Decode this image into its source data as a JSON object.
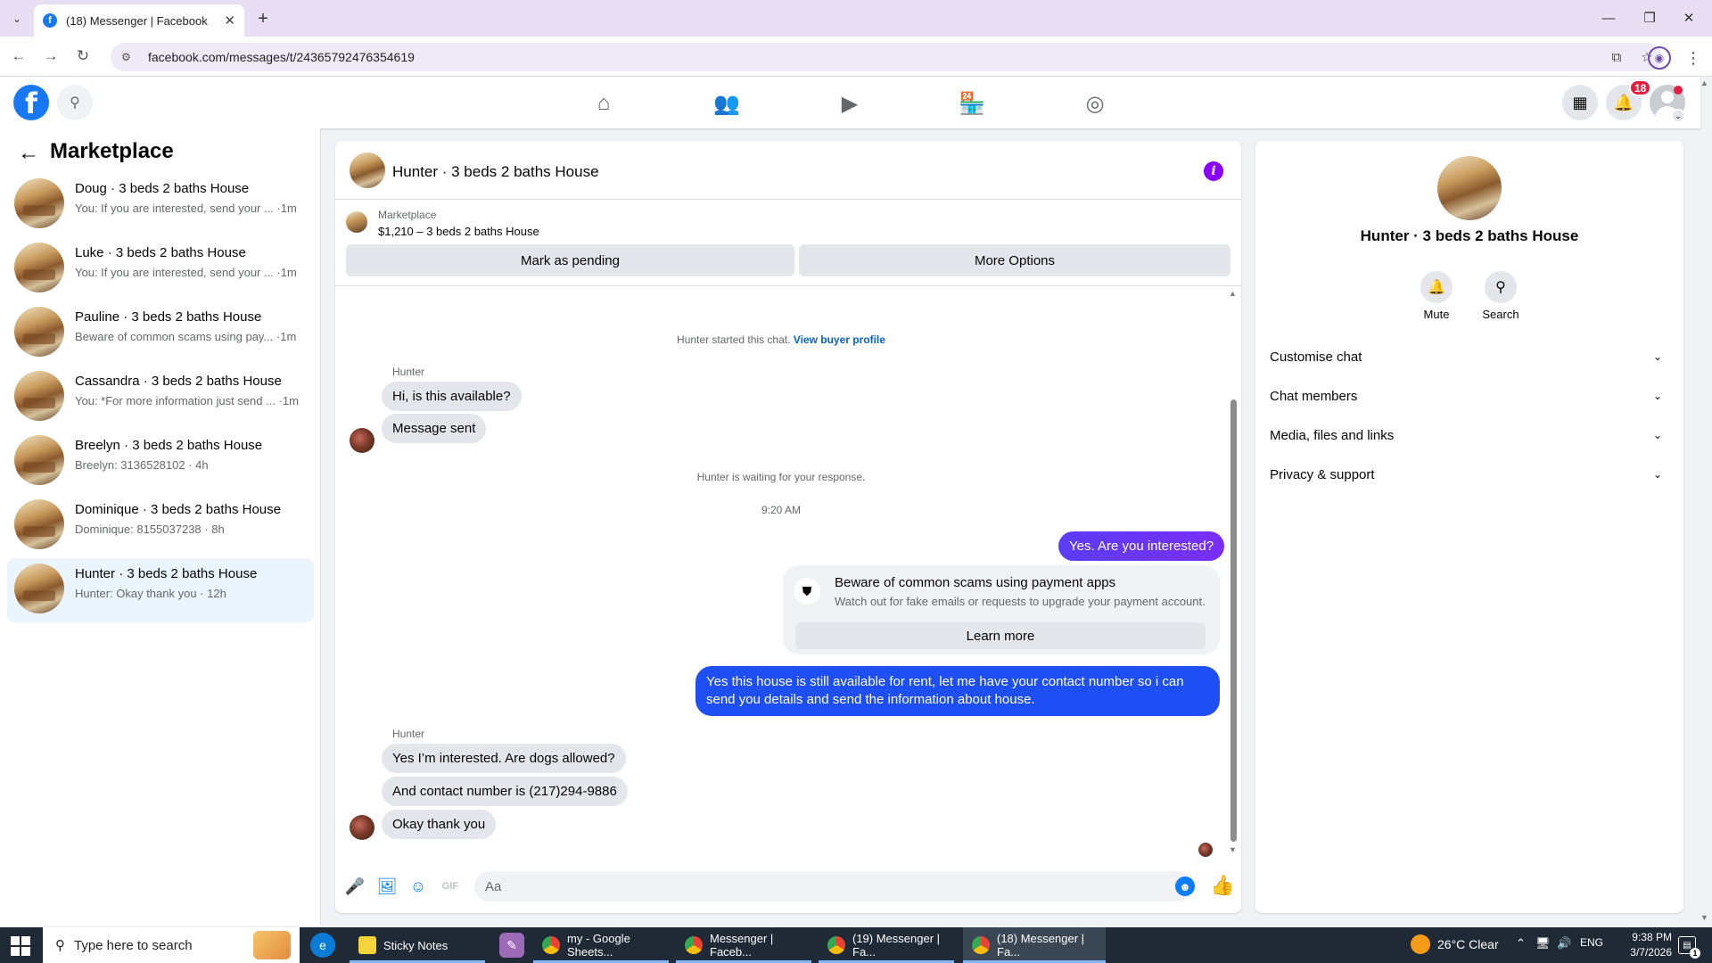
{
  "browser": {
    "tab_title": "(18) Messenger | Facebook",
    "url": "facebook.com/messages/t/24365792476354619"
  },
  "header": {
    "notification_count": "18"
  },
  "sidebar": {
    "title": "Marketplace",
    "conversations": [
      {
        "name": "Doug · 3 beds 2 baths House",
        "preview": "You: If you are interested, send your ... ·1m",
        "active": false
      },
      {
        "name": "Luke · 3 beds 2 baths House",
        "preview": "You: If you are interested, send your ... ·1m",
        "active": false
      },
      {
        "name": "Pauline · 3 beds 2 baths House",
        "preview": "Beware of common scams using pay... ·1m",
        "active": false
      },
      {
        "name": "Cassandra · 3 beds 2 baths House",
        "preview": "You: *For more information just send ... ·1m",
        "active": false
      },
      {
        "name": "Breelyn · 3 beds 2 baths House",
        "preview": "Breelyn: 3136528102 · 4h",
        "active": false
      },
      {
        "name": "Dominique · 3 beds 2 baths House",
        "preview": "Dominique: 8155037238 · 8h",
        "active": false
      },
      {
        "name": "Hunter · 3 beds 2 baths House",
        "preview": "Hunter: Okay thank you · 12h",
        "active": true
      }
    ]
  },
  "chat": {
    "title": "Hunter · 3 beds 2 baths House",
    "marketplace_label": "Marketplace",
    "listing": "$1,210 – 3 beds 2 baths House",
    "mark_pending": "Mark as pending",
    "more_options": "More Options",
    "started_text": "Hunter started this chat.",
    "view_profile": "View buyer profile",
    "sender_name": "Hunter",
    "msg_in_1": "Hi, is this available?",
    "msg_in_2": "Message sent",
    "waiting_text": "Hunter is waiting for your response.",
    "time": "9:20 AM",
    "msg_out_1": "Yes. Are you interested?",
    "scam_title": "Beware of common scams using payment apps",
    "scam_body": "Watch out for fake emails or requests to upgrade your payment account.",
    "learn_more": "Learn more",
    "msg_out_2_line1": "Yes this house is still available for rent, let me have your contact number so i can",
    "msg_out_2_line2": "send you details and send the information about house.",
    "sender_name_2": "Hunter",
    "msg_in_3": "Yes I’m interested. Are dogs allowed?",
    "msg_in_4": "And contact number is (217)294-9886",
    "msg_in_5": "Okay thank you",
    "composer_placeholder": "Aa"
  },
  "right_panel": {
    "title": "Hunter · 3 beds 2 baths House",
    "mute": "Mute",
    "search": "Search",
    "rows": [
      "Customise chat",
      "Chat members",
      "Media, files and links",
      "Privacy & support"
    ]
  },
  "taskbar": {
    "search_placeholder": "Type here to search",
    "apps": [
      {
        "label": "Sticky Notes"
      },
      {
        "label": "my - Google Sheets..."
      },
      {
        "label": "Messenger | Faceb..."
      },
      {
        "label": "(19) Messenger | Fa..."
      },
      {
        "label": "(18) Messenger | Fa..."
      }
    ],
    "weather": "26°C  Clear",
    "lang": "ENG",
    "time": "9:38 PM",
    "date": "3/7/2026",
    "notif_count": "1"
  },
  "colors": {
    "accent": "#1877f2",
    "outgoing_purple": "#7a2ef7",
    "outgoing_blue": "#1e4ff5"
  }
}
